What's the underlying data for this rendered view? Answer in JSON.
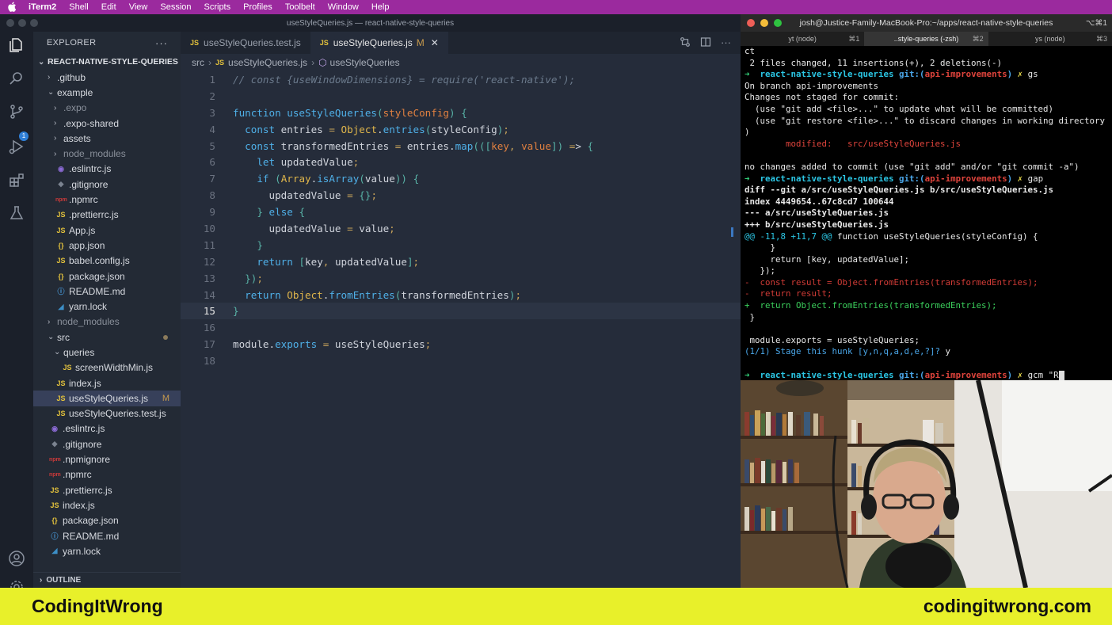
{
  "menubar": {
    "app": "iTerm2",
    "items": [
      "Shell",
      "Edit",
      "View",
      "Session",
      "Scripts",
      "Profiles",
      "Toolbelt",
      "Window",
      "Help"
    ]
  },
  "vscode": {
    "window_title": "useStyleQueries.js — react-native-style-queries",
    "explorer_title": "EXPLORER",
    "project": "REACT-NATIVE-STYLE-QUERIES",
    "scm_badge": "1",
    "outline": "OUTLINE",
    "tree": [
      {
        "label": ".github",
        "type": "folder",
        "open": false,
        "indent": 1
      },
      {
        "label": "example",
        "type": "folder",
        "open": true,
        "indent": 1
      },
      {
        "label": ".expo",
        "type": "folder",
        "open": false,
        "indent": 2,
        "dim": true
      },
      {
        "label": ".expo-shared",
        "type": "folder",
        "open": false,
        "indent": 2
      },
      {
        "label": "assets",
        "type": "folder",
        "open": false,
        "indent": 2
      },
      {
        "label": "node_modules",
        "type": "folder",
        "open": false,
        "indent": 2,
        "dim": true
      },
      {
        "label": ".eslintrc.js",
        "type": "eslint",
        "indent": 2
      },
      {
        "label": ".gitignore",
        "type": "git",
        "indent": 2
      },
      {
        "label": ".npmrc",
        "type": "npm",
        "indent": 2
      },
      {
        "label": ".prettierrc.js",
        "type": "js",
        "indent": 2
      },
      {
        "label": "App.js",
        "type": "js",
        "indent": 2
      },
      {
        "label": "app.json",
        "type": "json",
        "indent": 2
      },
      {
        "label": "babel.config.js",
        "type": "babel",
        "indent": 2
      },
      {
        "label": "package.json",
        "type": "json",
        "indent": 2
      },
      {
        "label": "README.md",
        "type": "info",
        "indent": 2
      },
      {
        "label": "yarn.lock",
        "type": "yarn",
        "indent": 2
      },
      {
        "label": "node_modules",
        "type": "folder",
        "open": false,
        "indent": 1,
        "dim": true
      },
      {
        "label": "src",
        "type": "folder",
        "open": true,
        "indent": 1,
        "dot": true
      },
      {
        "label": "queries",
        "type": "folder",
        "open": true,
        "indent": 2
      },
      {
        "label": "screenWidthMin.js",
        "type": "js",
        "indent": 3
      },
      {
        "label": "index.js",
        "type": "js",
        "indent": 2
      },
      {
        "label": "useStyleQueries.js",
        "type": "js",
        "indent": 2,
        "selected": true,
        "badge": "M"
      },
      {
        "label": "useStyleQueries.test.js",
        "type": "js",
        "indent": 2
      },
      {
        "label": ".eslintrc.js",
        "type": "eslint",
        "indent": 1
      },
      {
        "label": ".gitignore",
        "type": "git",
        "indent": 1
      },
      {
        "label": ".npmignore",
        "type": "npm",
        "indent": 1
      },
      {
        "label": ".npmrc",
        "type": "npm",
        "indent": 1
      },
      {
        "label": ".prettierrc.js",
        "type": "js",
        "indent": 1
      },
      {
        "label": "index.js",
        "type": "js",
        "indent": 1
      },
      {
        "label": "package.json",
        "type": "json",
        "indent": 1
      },
      {
        "label": "README.md",
        "type": "info",
        "indent": 1
      },
      {
        "label": "yarn.lock",
        "type": "yarn",
        "indent": 1
      }
    ],
    "tabs": [
      {
        "label": "useStyleQueries.test.js",
        "active": false
      },
      {
        "label": "useStyleQueries.js",
        "active": true,
        "modified": "M"
      }
    ],
    "breadcrumb": {
      "folder": "src",
      "file": "useStyleQueries.js",
      "symbol": "useStyleQueries"
    },
    "current_line": 15,
    "code": [
      "// const {useWindowDimensions} = require('react-native');",
      "",
      "function useStyleQueries(styleConfig) {",
      "  const entries = Object.entries(styleConfig);",
      "  const transformedEntries = entries.map(([key, value]) => {",
      "    let updatedValue;",
      "    if (Array.isArray(value)) {",
      "      updatedValue = {};",
      "    } else {",
      "      updatedValue = value;",
      "    }",
      "    return [key, updatedValue];",
      "  });",
      "  return Object.fromEntries(transformedEntries);",
      "}",
      "",
      "module.exports = useStyleQueries;",
      ""
    ]
  },
  "iterm": {
    "title": "josh@Justice-Family-MacBook-Pro:~/apps/react-native-style-queries",
    "title_shortcut": "⌥⌘1",
    "tabs": [
      {
        "label": "yt (node)",
        "shortcut": "⌘1"
      },
      {
        "label": "..style-queries (-zsh)",
        "shortcut": "⌘2",
        "active": true
      },
      {
        "label": "ys (node)",
        "shortcut": "⌘3"
      }
    ],
    "prompt_dir": "react-native-style-queries",
    "git_label": "git:(",
    "branch": "api-improvements",
    "git_close": ")",
    "lines": {
      "l0": "ct",
      "l1": " 2 files changed, 11 insertions(+), 2 deletions(-)",
      "cmd1": "gs",
      "l3": "On branch api-improvements",
      "l4": "Changes not staged for commit:",
      "l5": "  (use \"git add <file>...\" to update what will be committed)",
      "l6": "  (use \"git restore <file>...\" to discard changes in working directory",
      "l7": ")",
      "l8a": "        modified:   ",
      "l8b": "src/useStyleQueries.js",
      "l10": "no changes added to commit (use \"git add\" and/or \"git commit -a\")",
      "cmd2": "gap",
      "l12": "diff --git a/src/useStyleQueries.js b/src/useStyleQueries.js",
      "l13": "index 4449654..67c8cd7 100644",
      "l14": "--- a/src/useStyleQueries.js",
      "l15": "+++ b/src/useStyleQueries.js",
      "l16a": "@@ -11,8 +11,7 @@",
      "l16b": " function useStyleQueries(styleConfig) {",
      "l17": "     }",
      "l18": "     return [key, updatedValue];",
      "l19": "   });",
      "l20": "-  const result = Object.fromEntries(transformedEntries);",
      "l21": "-  return result;",
      "l22": "+  return Object.fromEntries(transformedEntries);",
      "l23": " }",
      "l25": " module.exports = useStyleQueries;",
      "l26a": "(1/1) Stage this hunk [y,n,q,a,d,e,?]?",
      "l26b": " y",
      "cmd3": "gcm \"R"
    }
  },
  "banner": {
    "left": "CodingItWrong",
    "right": "codingitwrong.com"
  }
}
